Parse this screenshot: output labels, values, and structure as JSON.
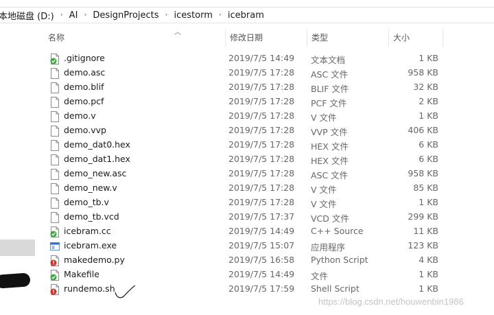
{
  "breadcrumb": [
    "本地磁盘 (D:)",
    "AI",
    "DesignProjects",
    "icestorm",
    "icebram"
  ],
  "breadcrumb_separator": "›",
  "columns": {
    "name": "名称",
    "date": "修改日期",
    "type": "类型",
    "size": "大小"
  },
  "files": [
    {
      "name": ".gitignore",
      "date": "2019/7/5 14:49",
      "type": "文本文档",
      "size": "1 KB",
      "icon": "git-tracked-file-icon"
    },
    {
      "name": "demo.asc",
      "date": "2019/7/5 17:28",
      "type": "ASC 文件",
      "size": "958 KB",
      "icon": "file-icon"
    },
    {
      "name": "demo.blif",
      "date": "2019/7/5 17:28",
      "type": "BLIF 文件",
      "size": "32 KB",
      "icon": "file-icon"
    },
    {
      "name": "demo.pcf",
      "date": "2019/7/5 17:28",
      "type": "PCF 文件",
      "size": "2 KB",
      "icon": "file-icon"
    },
    {
      "name": "demo.v",
      "date": "2019/7/5 17:28",
      "type": "V 文件",
      "size": "1 KB",
      "icon": "file-icon"
    },
    {
      "name": "demo.vvp",
      "date": "2019/7/5 17:28",
      "type": "VVP 文件",
      "size": "406 KB",
      "icon": "file-icon"
    },
    {
      "name": "demo_dat0.hex",
      "date": "2019/7/5 17:28",
      "type": "HEX 文件",
      "size": "6 KB",
      "icon": "file-icon"
    },
    {
      "name": "demo_dat1.hex",
      "date": "2019/7/5 17:28",
      "type": "HEX 文件",
      "size": "6 KB",
      "icon": "file-icon"
    },
    {
      "name": "demo_new.asc",
      "date": "2019/7/5 17:28",
      "type": "ASC 文件",
      "size": "958 KB",
      "icon": "file-icon"
    },
    {
      "name": "demo_new.v",
      "date": "2019/7/5 17:28",
      "type": "V 文件",
      "size": "85 KB",
      "icon": "file-icon"
    },
    {
      "name": "demo_tb.v",
      "date": "2019/7/5 17:28",
      "type": "V 文件",
      "size": "1 KB",
      "icon": "file-icon"
    },
    {
      "name": "demo_tb.vcd",
      "date": "2019/7/5 17:37",
      "type": "VCD 文件",
      "size": "299 KB",
      "icon": "file-icon"
    },
    {
      "name": "icebram.cc",
      "date": "2019/7/5 14:49",
      "type": "C++ Source",
      "size": "11 KB",
      "icon": "git-tracked-source-icon"
    },
    {
      "name": "icebram.exe",
      "date": "2019/7/5 15:07",
      "type": "应用程序",
      "size": "123 KB",
      "icon": "exe-icon"
    },
    {
      "name": "makedemo.py",
      "date": "2019/7/5 16:58",
      "type": "Python Script",
      "size": "4 KB",
      "icon": "git-modified-file-icon"
    },
    {
      "name": "Makefile",
      "date": "2019/7/5 14:49",
      "type": "文件",
      "size": "1 KB",
      "icon": "git-tracked-file-icon"
    },
    {
      "name": "rundemo.sh",
      "date": "2019/7/5 17:59",
      "type": "Shell Script",
      "size": "1 KB",
      "icon": "git-modified-file-icon"
    }
  ],
  "watermark": "https://blog.csdn.net/houwenbin1986",
  "colors": {
    "git_green": "#3aa83a",
    "git_red": "#d93025",
    "exe_blue": "#2f6fd6"
  }
}
